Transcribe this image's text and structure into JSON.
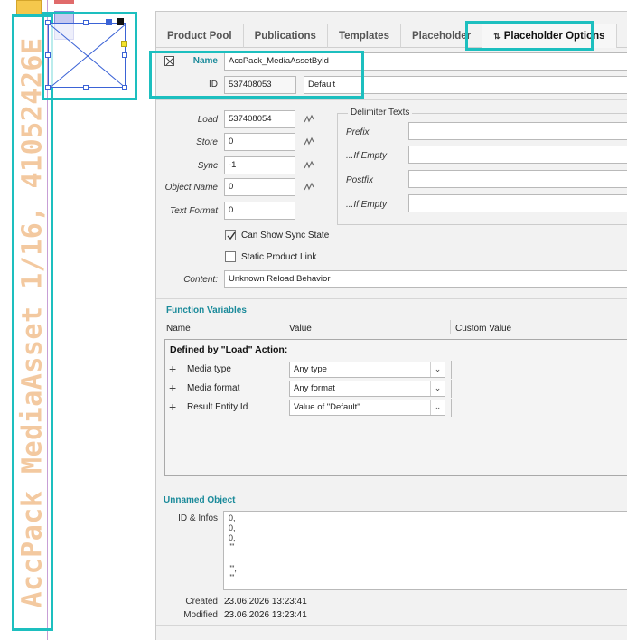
{
  "canvas": {
    "vertical_label": "AccPack MediaAsset 1/16, 41052426E"
  },
  "tabs": [
    {
      "label": "Product Pool"
    },
    {
      "label": "Publications"
    },
    {
      "label": "Templates"
    },
    {
      "label": "Placeholder"
    },
    {
      "label": "Placeholder Options",
      "icon": "sort-icon"
    }
  ],
  "header": {
    "name_label": "Name",
    "name_value": "AccPack_MediaAssetById",
    "id_label": "ID",
    "id_value": "537408053",
    "id_extra_value": "Default"
  },
  "load": {
    "fields": [
      {
        "label": "Load",
        "value": "537408054"
      },
      {
        "label": "Store",
        "value": "0"
      },
      {
        "label": "Sync",
        "value": "-1"
      },
      {
        "label": "Object Name",
        "value": "0"
      },
      {
        "label": "Text Format",
        "value": "0"
      }
    ],
    "delimiter": {
      "title": "Delimiter Texts",
      "fields": [
        {
          "label": "Prefix",
          "value": ""
        },
        {
          "label": "...If Empty",
          "value": ""
        },
        {
          "label": "Postfix",
          "value": ""
        },
        {
          "label": "...If Empty",
          "value": ""
        }
      ]
    },
    "can_show_sync_label": "Can Show Sync State",
    "can_show_sync_checked": true,
    "static_link_label": "Static Product Link",
    "static_link_checked": false,
    "content_label": "Content:",
    "content_value": "Unknown Reload Behavior"
  },
  "function_variables": {
    "title": "Function Variables",
    "columns": [
      "Name",
      "Value",
      "Custom Value"
    ],
    "group_label": "Defined by \"Load\" Action:",
    "rows": [
      {
        "name": "Media type",
        "value": "Any type"
      },
      {
        "name": "Media format",
        "value": "Any format"
      },
      {
        "name": "Result Entity Id",
        "value": "Value of \"Default\""
      }
    ]
  },
  "object": {
    "title": "Unnamed Object",
    "id_infos_label": "ID & Infos",
    "id_infos_lines": [
      "0,",
      "0,",
      "0,",
      "\"\"",
      "",
      "\"\",",
      "\"\""
    ],
    "created_label": "Created",
    "created_value": "23.06.2026 13:23:41",
    "modified_label": "Modified",
    "modified_value": "23.06.2026 13:23:41"
  },
  "colors": {
    "highlight": "#1dbfbf",
    "section_title": "#1a8a9a",
    "frame_selection": "#3b63d6"
  }
}
